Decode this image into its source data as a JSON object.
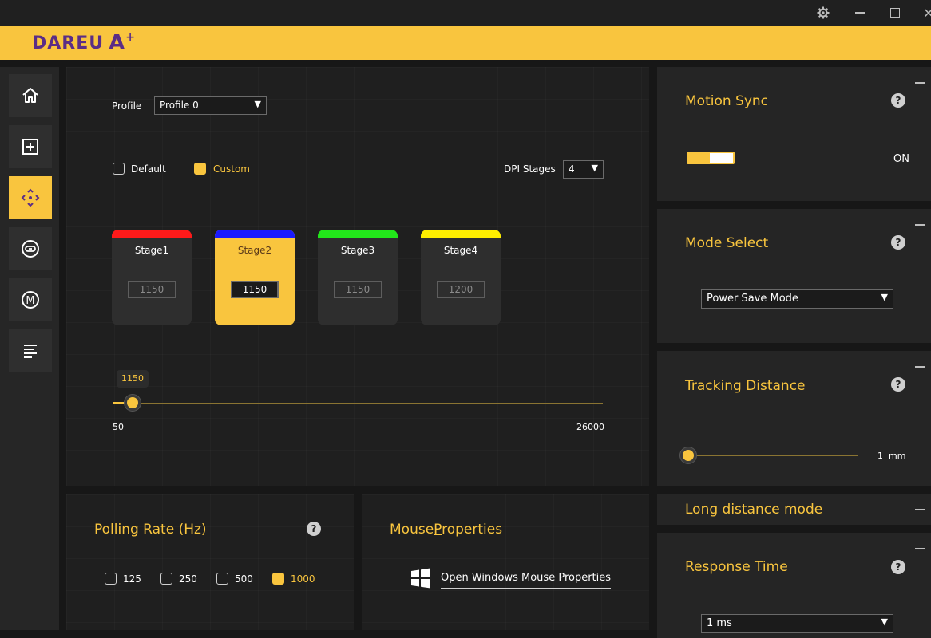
{
  "brand": {
    "name": "DAREU",
    "mark": "A",
    "accent": "#f9c53e",
    "purple": "#5b2d86"
  },
  "window": {
    "settings_icon": "gear-icon",
    "minimize_icon": "minimize-icon",
    "maximize_icon": "maximize-icon",
    "close_icon": "close-icon"
  },
  "sidebar": {
    "items": [
      {
        "name": "home",
        "icon": "home-icon",
        "active": false
      },
      {
        "name": "add",
        "icon": "plus-square-icon",
        "active": false
      },
      {
        "name": "dpi",
        "icon": "crosshair-move-icon",
        "active": true
      },
      {
        "name": "link",
        "icon": "link-icon",
        "active": false
      },
      {
        "name": "macro",
        "icon": "macro-m-icon",
        "active": false
      },
      {
        "name": "list",
        "icon": "list-icon",
        "active": false
      }
    ]
  },
  "dpi": {
    "profile_label": "Profile",
    "profile_value": "Profile 0",
    "mode_default": "Default",
    "mode_custom": "Custom",
    "stages_label": "DPI  Stages",
    "stages_value": "4",
    "stages": [
      {
        "name": "Stage1",
        "value": "1150",
        "color": "#ff1a1a",
        "active": false
      },
      {
        "name": "Stage2",
        "value": "1150",
        "color": "#1a1aff",
        "active": true
      },
      {
        "name": "Stage3",
        "value": "1150",
        "color": "#22e61a",
        "active": false
      },
      {
        "name": "Stage4",
        "value": "1200",
        "color": "#ffee00",
        "active": false
      }
    ],
    "slider": {
      "tooltip": "1150",
      "min": "50",
      "max": "26000",
      "value": 1150
    }
  },
  "polling": {
    "title": "Polling Rate (Hz)",
    "options": [
      "125",
      "250",
      "500",
      "1000"
    ],
    "selected": "1000"
  },
  "mouse_props": {
    "title_prefix": "Mouse",
    "title_underlined": "P",
    "title_suffix": "roperties",
    "link": "Open Windows Mouse Properties"
  },
  "motion_sync": {
    "title": "Motion Sync",
    "state": "ON"
  },
  "mode_select": {
    "title": "Mode Select",
    "value": "Power Save Mode"
  },
  "tracking": {
    "title": "Tracking Distance",
    "value": "1",
    "unit": "mm"
  },
  "long_distance": {
    "title": "Long distance mode"
  },
  "response": {
    "title": "Response Time",
    "value": "1 ms"
  }
}
